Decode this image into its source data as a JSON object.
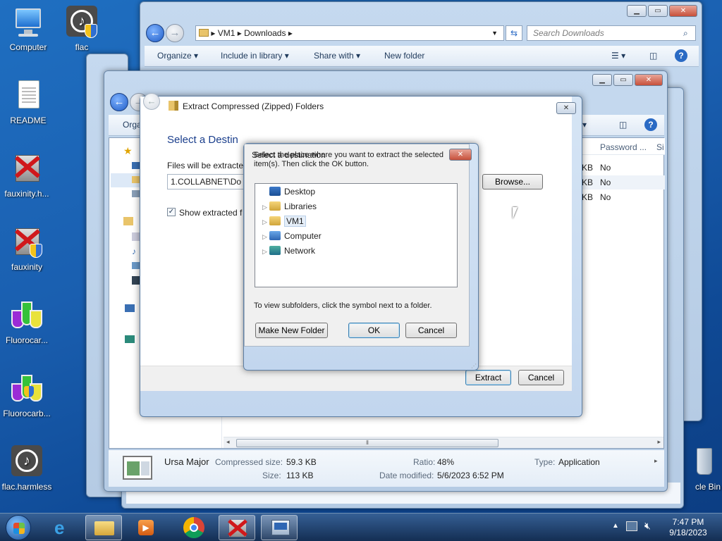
{
  "desktop": {
    "icons": [
      {
        "label": "Computer"
      },
      {
        "label": "flac"
      },
      {
        "label": "README"
      },
      {
        "label": "fauxinity.h..."
      },
      {
        "label": "fauxinity"
      },
      {
        "label": "Fluorocar..."
      },
      {
        "label": "Fluorocarb..."
      },
      {
        "label": "flac.harmless"
      },
      {
        "label": "cle Bin"
      }
    ]
  },
  "explorer_back": {
    "address": {
      "seg1": "VM1",
      "seg2": "Downloads"
    },
    "search_placeholder": "Search Downloads",
    "toolbar": {
      "organize": "Organize",
      "include": "Include in library",
      "share": "Share with",
      "new_folder": "New folder"
    }
  },
  "explorer_mid": {
    "toolbar_partial": "Orga",
    "columns": {
      "password": "Password ...",
      "size": "Si"
    },
    "rows": [
      {
        "kb": "KB",
        "protected": "No"
      },
      {
        "kb": "KB",
        "protected": "No"
      },
      {
        "kb": "KB",
        "protected": "No"
      }
    ],
    "details": {
      "name": "Ursa Major",
      "compressed_label": "Compressed size:",
      "compressed_value": "59.3 KB",
      "size_label": "Size:",
      "size_value": "113 KB",
      "ratio_label": "Ratio:",
      "ratio_value": "48%",
      "modified_label": "Date modified:",
      "modified_value": "5/6/2023 6:52 PM",
      "type_label": "Type:",
      "type_value": "Application"
    }
  },
  "extract": {
    "title": "Extract Compressed (Zipped) Folders",
    "heading": "Select a Destin",
    "files_label": "Files will be extracte",
    "path_value": "1.COLLABNET\\Do",
    "browse": "Browse...",
    "show_checkbox_label": "Show extracted f",
    "extract_btn": "Extract",
    "cancel_btn": "Cancel"
  },
  "select_dest": {
    "title": "Select a destination",
    "instruction": "Select the place where you want to extract the selected item(s).  Then click the OK button.",
    "tree": [
      {
        "label": "Desktop",
        "expander": ""
      },
      {
        "label": "Libraries",
        "expander": "▷"
      },
      {
        "label": "VM1",
        "expander": "▷"
      },
      {
        "label": "Computer",
        "expander": "▷"
      },
      {
        "label": "Network",
        "expander": "▷"
      }
    ],
    "hint": "To view subfolders, click the symbol next to a folder.",
    "make_new_folder": "Make New Folder",
    "ok": "OK",
    "cancel": "Cancel"
  },
  "taskbar": {
    "time": "7:47 PM",
    "date": "9/18/2023"
  }
}
